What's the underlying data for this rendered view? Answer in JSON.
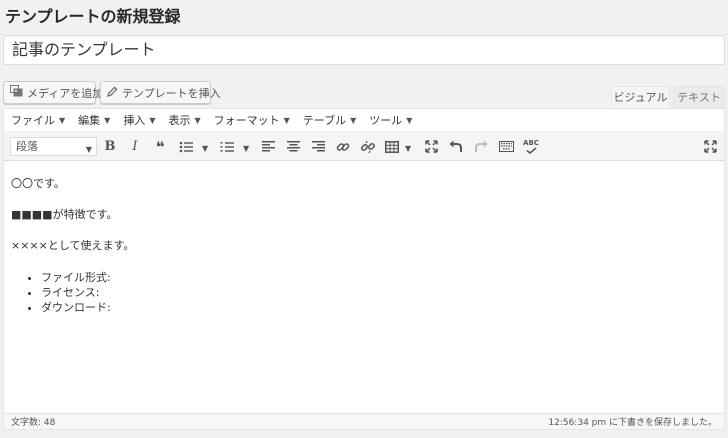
{
  "page": {
    "title": "テンプレートの新規登録"
  },
  "title_field": {
    "value": "記事のテンプレート"
  },
  "buttons": {
    "add_media": "メディアを追加",
    "insert_template": "テンプレートを挿入"
  },
  "tabs": {
    "visual": "ビジュアル",
    "text": "テキスト"
  },
  "menubar": [
    {
      "label": "ファイル"
    },
    {
      "label": "編集"
    },
    {
      "label": "挿入"
    },
    {
      "label": "表示"
    },
    {
      "label": "フォーマット"
    },
    {
      "label": "テーブル"
    },
    {
      "label": "ツール"
    }
  ],
  "toolbar": {
    "format_value": "段落",
    "icons": [
      "bold-icon",
      "italic-icon",
      "blockquote-icon",
      "bullet-list-icon",
      "numbered-list-icon",
      "align-left-icon",
      "align-center-icon",
      "align-right-icon",
      "link-icon",
      "unlink-icon",
      "table-icon",
      "fullscreen-icon",
      "undo-icon",
      "redo-icon",
      "keyboard-icon",
      "spellcheck-icon",
      "distraction-free-icon"
    ],
    "bold_glyph": "B",
    "italic_glyph": "I",
    "quote_glyph": "❝",
    "spell_glyph": "ABC"
  },
  "content": {
    "paragraphs": [
      "〇〇です。",
      "■■■■が特徴です。",
      "××××として使えます。"
    ],
    "list": [
      "ファイル形式:",
      "ライセンス:",
      "ダウンロード:"
    ]
  },
  "status": {
    "word_count": "文字数: 48",
    "saved": "12:56:34 pm に下書きを保存しました。"
  },
  "colors": {
    "background": "#f1f1f1",
    "editor_bg": "#ffffff",
    "toolbar_bg": "#f5f5f5",
    "text": "#23282d"
  }
}
